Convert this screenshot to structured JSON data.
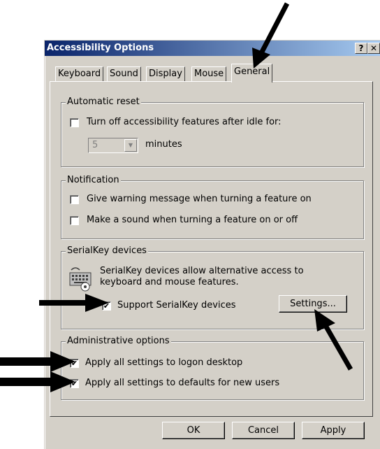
{
  "window": {
    "title": "Accessibility Options",
    "help_glyph": "?",
    "close_glyph": "✕"
  },
  "tabs": [
    {
      "label": "Keyboard"
    },
    {
      "label": "Sound"
    },
    {
      "label": "Display"
    },
    {
      "label": "Mouse"
    },
    {
      "label": "General",
      "active": true
    }
  ],
  "automatic_reset": {
    "title": "Automatic reset",
    "turn_off_label": "Turn off accessibility features after idle for:",
    "turn_off_checked": false,
    "minutes_value": "5",
    "minutes_label": "minutes"
  },
  "notification": {
    "title": "Notification",
    "warning_label": "Give warning message when turning a feature on",
    "warning_checked": false,
    "sound_label": "Make a sound when turning a feature on or off",
    "sound_checked": false
  },
  "serialkey": {
    "title": "SerialKey devices",
    "description_line1": "SerialKey devices allow alternative access to",
    "description_line2": "keyboard and mouse features.",
    "support_label": "Support SerialKey devices",
    "support_checked": true,
    "settings_button": "Settings..."
  },
  "admin": {
    "title": "Administrative options",
    "logon_label": "Apply all settings to logon desktop",
    "logon_checked": true,
    "defaults_label": "Apply all settings to defaults for new users",
    "defaults_checked": true
  },
  "buttons": {
    "ok": "OK",
    "cancel": "Cancel",
    "apply": "Apply"
  },
  "check_glyph": "✔",
  "icons": {
    "keyboard": "keyboard-icon",
    "annotation_arrow": "arrow-annotation"
  },
  "colors": {
    "dialog_bg": "#d4d0c8",
    "titlebar_start": "#0a246a",
    "titlebar_end": "#a6caf0",
    "arrow": "#000000"
  }
}
